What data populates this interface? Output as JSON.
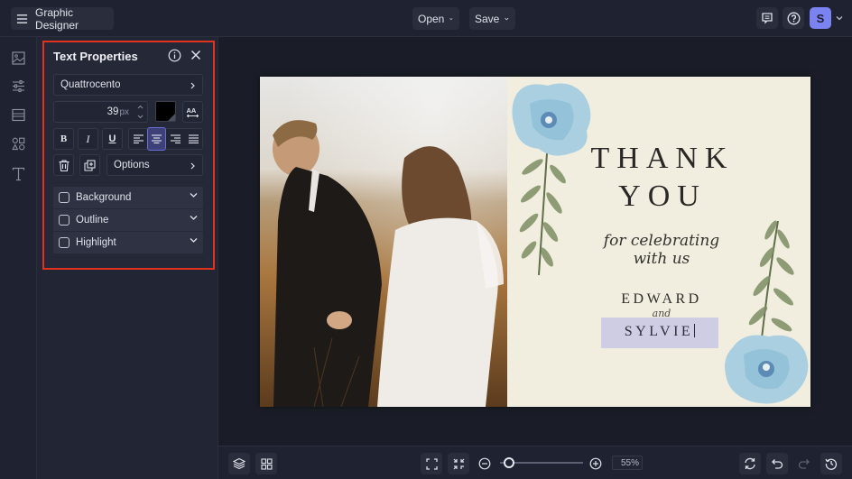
{
  "topbar": {
    "app_title": "Graphic Designer",
    "open_label": "Open",
    "save_label": "Save",
    "avatar_initial": "S",
    "icons": [
      "menu-icon",
      "comment-icon",
      "help-icon",
      "chevron-down-icon"
    ]
  },
  "rail": {
    "items": [
      {
        "name": "photos",
        "icon": "image-icon"
      },
      {
        "name": "adjustments",
        "icon": "sliders-icon"
      },
      {
        "name": "backgrounds",
        "icon": "layout-icon"
      },
      {
        "name": "graphics",
        "icon": "shapes-icon"
      },
      {
        "name": "text",
        "icon": "text-icon"
      }
    ]
  },
  "text_properties": {
    "title": "Text Properties",
    "font_name": "Quattrocento",
    "font_size": "39",
    "font_size_unit": "px",
    "text_color": "#000000",
    "style_buttons": [
      "B",
      "I",
      "U"
    ],
    "alignment": {
      "options": [
        "left",
        "center",
        "right",
        "justify"
      ],
      "selected": "center"
    },
    "options_label": "Options",
    "accordions": [
      {
        "label": "Background",
        "checked": false
      },
      {
        "label": "Outline",
        "checked": false
      },
      {
        "label": "Highlight",
        "checked": false
      }
    ],
    "highlight_color": "#e0331f"
  },
  "design": {
    "headline": [
      "THANK",
      "YOU"
    ],
    "subline": [
      "for celebrating",
      "with us"
    ],
    "name1": "EDWARD",
    "conjunction": "and",
    "name2": "SYLVIE",
    "card_color": "#f2eedf",
    "selection_color": "#cfcde3"
  },
  "bottombar": {
    "zoom_value": "55%",
    "zoom_level_percent": 55
  }
}
